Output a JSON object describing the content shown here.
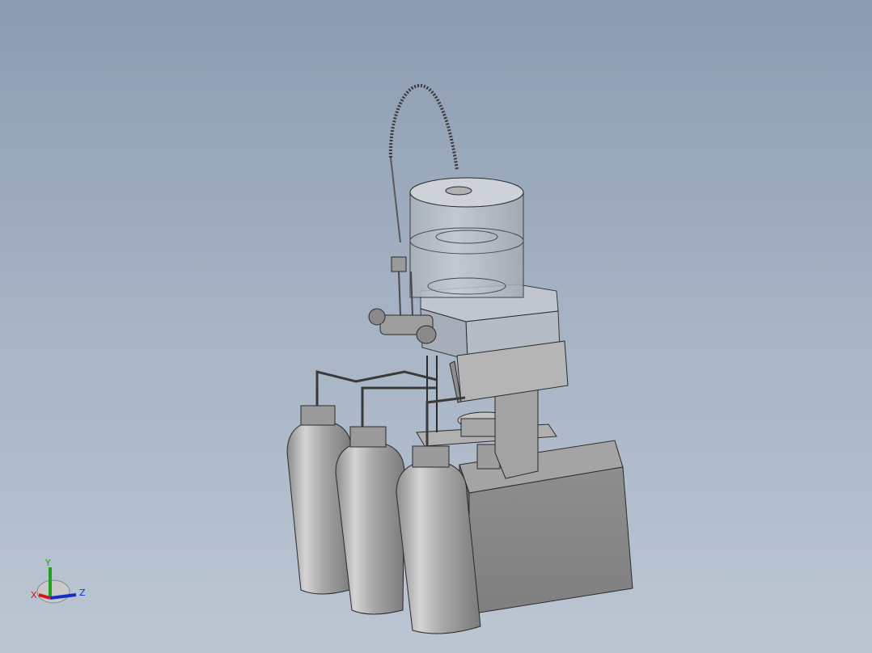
{
  "triad": {
    "x_label": "X",
    "y_label": "Y",
    "z_label": "Z",
    "x_color": "#d01818",
    "y_color": "#1fa01f",
    "z_color": "#1030c8"
  },
  "colors": {
    "metal": "#9a9a9a",
    "metal_dark": "#707070",
    "glass": "#b9c0c9",
    "base": "#8a8a8a",
    "edge": "#2b2b2b"
  }
}
